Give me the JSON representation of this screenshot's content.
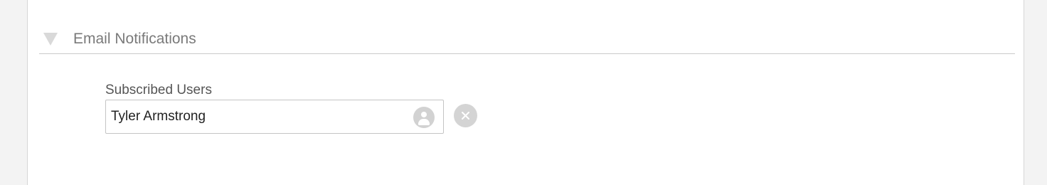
{
  "section": {
    "title": "Email Notifications",
    "expanded": true,
    "toggle_icon": "triangle-down-icon"
  },
  "subscribed_users": {
    "label": "Subscribed Users",
    "users": [
      {
        "name": "Tyler Armstrong",
        "lookup_icon": "person-icon",
        "remove_icon": "close-icon"
      }
    ]
  },
  "colors": {
    "page_background": "#f3f3f3",
    "panel_background": "#ffffff",
    "header_text": "#7a7a7a",
    "divider": "#c9c9c9",
    "icon_gray": "#d2d2d2"
  }
}
